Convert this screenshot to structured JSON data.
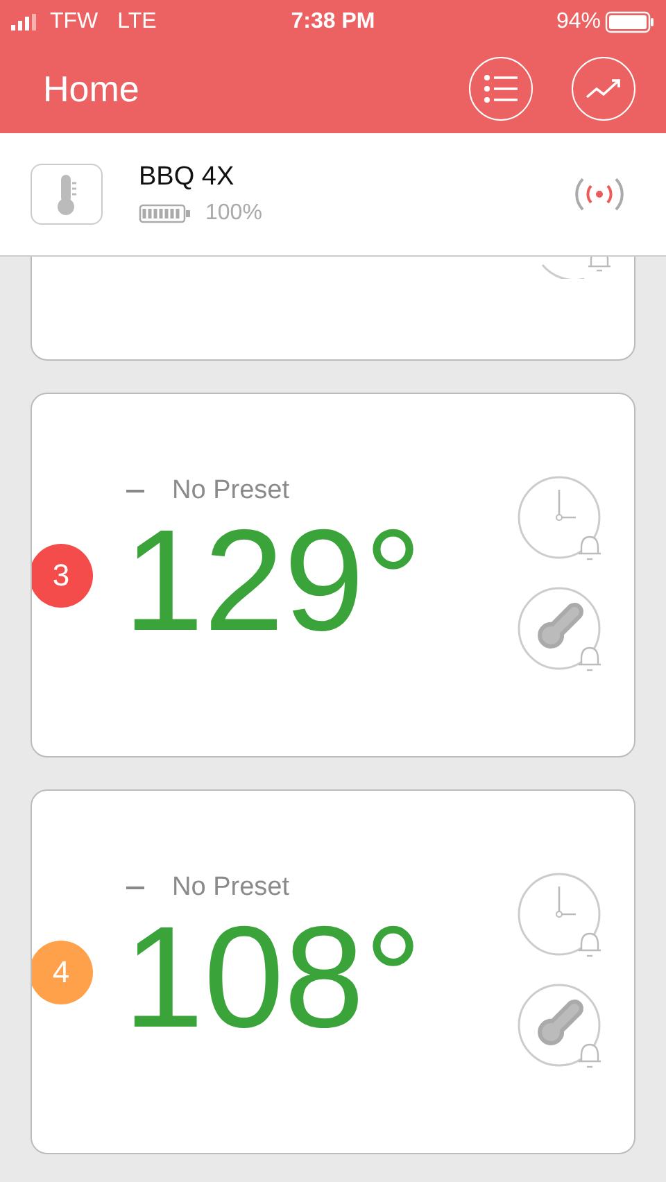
{
  "status_bar": {
    "carrier": "TFW",
    "network": "LTE",
    "time": "7:38 PM",
    "battery": "94%"
  },
  "nav": {
    "title": "Home"
  },
  "device": {
    "name": "BBQ 4X",
    "battery": "100%"
  },
  "probes": [
    {
      "number": "3",
      "color": "#f44b4b",
      "preset": "No Preset",
      "temperature": "129°"
    },
    {
      "number": "4",
      "color": "#ffa04a",
      "preset": "No Preset",
      "temperature": "108°"
    }
  ]
}
